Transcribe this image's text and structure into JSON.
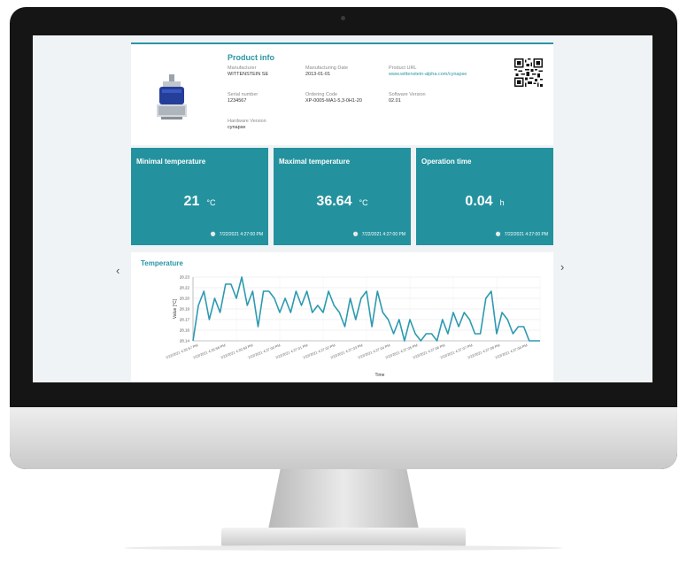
{
  "product_info": {
    "title": "Product info",
    "fields": [
      {
        "label": "Manufacturer",
        "value": "WITTENSTEIN SE"
      },
      {
        "label": "Manufacturing Date",
        "value": "2013-01-01"
      },
      {
        "label": "Product URL",
        "value": "www.wittenstein-alpha.com/cynapse"
      },
      {
        "label": "Serial number",
        "value": "1234567"
      },
      {
        "label": "Ordering Code",
        "value": "XP-0005-MA1-5,3-0H1-20"
      },
      {
        "label": "Software Version",
        "value": "02.01"
      },
      {
        "label": "Hardware Version",
        "value": "cynapse"
      }
    ]
  },
  "cards": [
    {
      "title": "Minimal temperature",
      "value": "21",
      "unit": "°C",
      "timestamp": "7/22/2021 4:27:00 PM"
    },
    {
      "title": "Maximal temperature",
      "value": "36.64",
      "unit": "°C",
      "timestamp": "7/22/2021 4:27:00 PM"
    },
    {
      "title": "Operation time",
      "value": "0.04",
      "unit": "h",
      "timestamp": "7/22/2021 4:27:00 PM"
    }
  ],
  "nav": {
    "prev": "‹",
    "next": "›"
  },
  "icons": {
    "clock": "clock-icon",
    "prev": "chevron-left-icon",
    "next": "chevron-right-icon",
    "qr": "qr-code-icon"
  },
  "colors": {
    "accent": "#2a96a5",
    "card_bg": "#23929e",
    "line": "#2d9ab0"
  },
  "chart_data": {
    "type": "line",
    "title": "Temperature",
    "xlabel": "Time",
    "ylabel": "Value [°C]",
    "ylim": [
      28.14,
      28.23
    ],
    "y_ticks": [
      "28.23",
      "28.22",
      "28.20",
      "28.19",
      "28.17",
      "28.16",
      "28.14"
    ],
    "x_ticks": [
      "7/22/2021 4:26:57 PM",
      "7/22/2021 4:26:58 PM",
      "7/22/2021 4:26:59 PM",
      "7/22/2021 4:27:00 PM",
      "7/22/2021 4:27:01 PM",
      "7/22/2021 4:27:02 PM",
      "7/22/2021 4:27:03 PM",
      "7/22/2021 4:27:04 PM",
      "7/22/2021 4:27:05 PM",
      "7/22/2021 4:27:06 PM",
      "7/22/2021 4:27:07 PM",
      "7/22/2021 4:27:08 PM",
      "7/22/2021 4:27:09 PM"
    ],
    "grid": true,
    "series": [
      {
        "values": [
          28.14,
          28.19,
          28.21,
          28.17,
          28.2,
          28.18,
          28.22,
          28.22,
          28.2,
          28.23,
          28.19,
          28.21,
          28.16,
          28.21,
          28.21,
          28.2,
          28.18,
          28.2,
          28.18,
          28.21,
          28.19,
          28.21,
          28.18,
          28.19,
          28.18,
          28.21,
          28.19,
          28.18,
          28.16,
          28.2,
          28.17,
          28.2,
          28.21,
          28.16,
          28.21,
          28.18,
          28.17,
          28.15,
          28.17,
          28.14,
          28.17,
          28.15,
          28.14,
          28.15,
          28.15,
          28.14,
          28.17,
          28.15,
          28.18,
          28.16,
          28.18,
          28.17,
          28.15,
          28.15,
          28.2,
          28.21,
          28.15,
          28.18,
          28.17,
          28.15,
          28.16,
          28.16,
          28.14,
          28.14,
          28.14
        ]
      }
    ]
  }
}
